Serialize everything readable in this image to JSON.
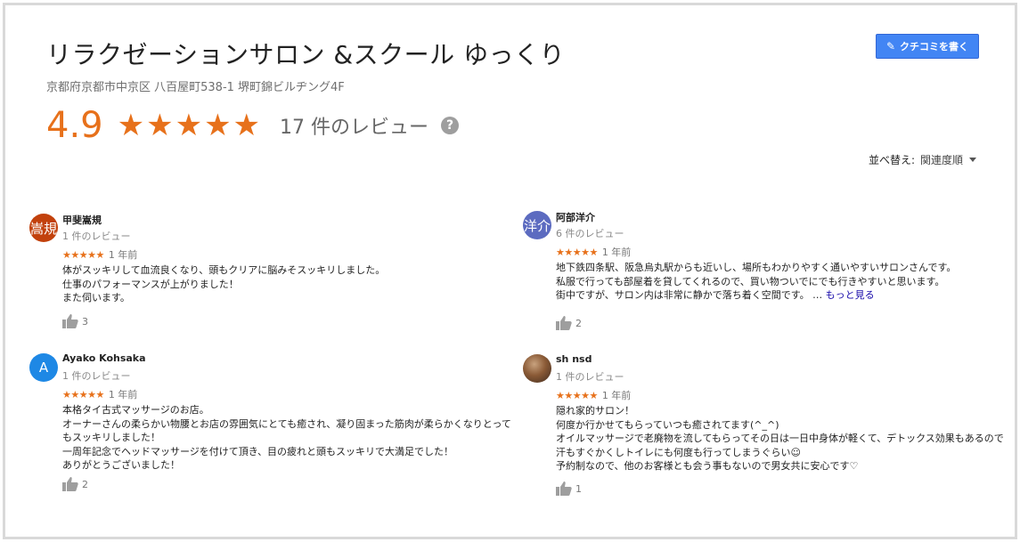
{
  "business": {
    "name": "リラクゼーションサロン &スクール ゆっくり",
    "address": "京都府京都市中京区 八百屋町538-1 堺町錦ビルヂング4F",
    "rating": "4.9",
    "stars": "★★★★★",
    "review_count": "17 件のレビュー"
  },
  "write_review_label": "クチコミを書く",
  "sort": {
    "label": "並べ替え:",
    "selected": "関連度順"
  },
  "colors": {
    "accent_orange": "#e7711b",
    "button_blue": "#4285f4",
    "link_blue": "#1a0dab"
  },
  "reviews": [
    {
      "avatar_text": "嵩規",
      "avatar_color": "#c2410c",
      "name": "甲斐嵩規",
      "review_count": "1 件のレビュー",
      "stars": "★★★★★",
      "date": "1 年前",
      "text": "体がスッキリして血流良くなり、頭もクリアに脳みそスッキリしました。\n仕事のパフォーマンスが上がりました！\nまた伺います。",
      "more": "",
      "likes": "3"
    },
    {
      "avatar_text": "洋介",
      "avatar_color": "#5c6bc0",
      "name": "阿部洋介",
      "review_count": "6 件のレビュー",
      "stars": "★★★★★",
      "date": "1 年前",
      "text": "地下鉄四条駅、阪急烏丸駅からも近いし、場所もわかりやすく通いやすいサロンさんです。\n私服で行っても部屋着を貸してくれるので、買い物ついでにでも行きやすいと思います。\n街中ですが、サロン内は非常に静かで落ち着く空間です。 … ",
      "more": "もっと見る",
      "likes": "2"
    },
    {
      "avatar_text": "A",
      "avatar_color": "#1e88e5",
      "name": "Ayako Kohsaka",
      "review_count": "1 件のレビュー",
      "stars": "★★★★★",
      "date": "1 年前",
      "text": "本格タイ古式マッサージのお店。\nオーナーさんの柔らかい物腰とお店の雰囲気にとても癒され、凝り固まった筋肉が柔らかくなりとって\nもスッキリしました！\n一周年記念でヘッドマッサージを付けて頂き、目の疲れと頭もスッキリで大満足でした！\nありがとうございました！",
      "more": "",
      "likes": "2"
    },
    {
      "avatar_text": "",
      "avatar_color": "#6d4c41",
      "name": "sh nsd",
      "review_count": "1 件のレビュー",
      "stars": "★★★★★",
      "date": "1 年前",
      "text": "隠れ家的サロン！\n何度か行かせてもらっていつも癒されてます(^_^)\nオイルマッサージで老廃物を流してもらってその日は一日中身体が軽くて、デトックス効果もあるので\n汗もすぐかくしトイレにも何度も行ってしまうぐらい☺\n予約制なので、他のお客様とも会う事もないので男女共に安心です♡",
      "more": "",
      "likes": "1"
    }
  ]
}
